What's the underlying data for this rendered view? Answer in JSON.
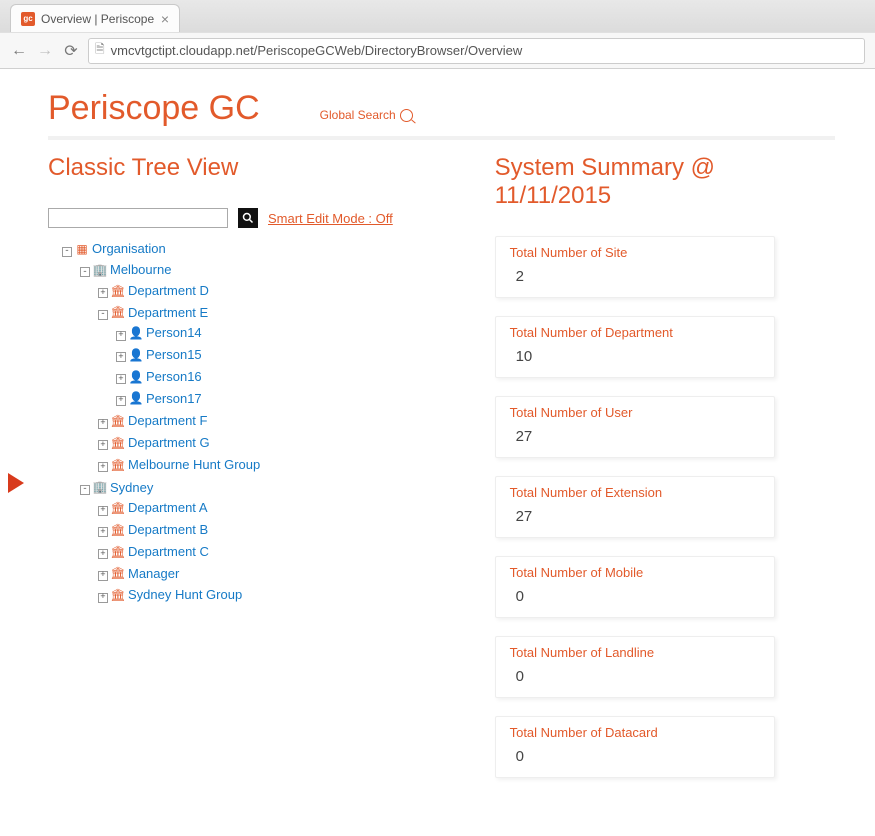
{
  "browser": {
    "tab_title": "Overview | Periscope",
    "favicon_text": "gc",
    "url": "vmcvtgctipt.cloudapp.net/PeriscopeGCWeb/DirectoryBrowser/Overview"
  },
  "header": {
    "app_title": "Periscope GC",
    "global_search_label": "Global Search"
  },
  "left": {
    "section_title": "Classic Tree View",
    "smart_edit_label": "Smart Edit Mode : Off",
    "search_placeholder": ""
  },
  "right": {
    "section_title": "System Summary @ 11/11/2015",
    "cards": [
      {
        "title": "Total Number of Site",
        "value": "2"
      },
      {
        "title": "Total Number of Department",
        "value": "10"
      },
      {
        "title": "Total Number of User",
        "value": "27"
      },
      {
        "title": "Total Number of Extension",
        "value": "27"
      },
      {
        "title": "Total Number of Mobile",
        "value": "0"
      },
      {
        "title": "Total Number of Landline",
        "value": "0"
      },
      {
        "title": "Total Number of Datacard",
        "value": "0"
      }
    ]
  },
  "tree": {
    "root_label": "Organisation",
    "sites": [
      {
        "label": "Melbourne",
        "expanded": true,
        "children": [
          {
            "label": "Department D",
            "expanded": false,
            "type": "dept"
          },
          {
            "label": "Department E",
            "expanded": true,
            "type": "dept",
            "children": [
              {
                "label": "Person14",
                "type": "user"
              },
              {
                "label": "Person15",
                "type": "user"
              },
              {
                "label": "Person16",
                "type": "user"
              },
              {
                "label": "Person17",
                "type": "user"
              }
            ]
          },
          {
            "label": "Department F",
            "expanded": false,
            "type": "dept"
          },
          {
            "label": "Department G",
            "expanded": false,
            "type": "dept"
          },
          {
            "label": "Melbourne Hunt Group",
            "expanded": false,
            "type": "dept"
          }
        ]
      },
      {
        "label": "Sydney",
        "expanded": true,
        "children": [
          {
            "label": "Department A",
            "expanded": false,
            "type": "dept"
          },
          {
            "label": "Department B",
            "expanded": false,
            "type": "dept"
          },
          {
            "label": "Department C",
            "expanded": false,
            "type": "dept"
          },
          {
            "label": "Manager",
            "expanded": false,
            "type": "dept"
          },
          {
            "label": "Sydney Hunt Group",
            "expanded": false,
            "type": "dept"
          }
        ]
      }
    ]
  }
}
